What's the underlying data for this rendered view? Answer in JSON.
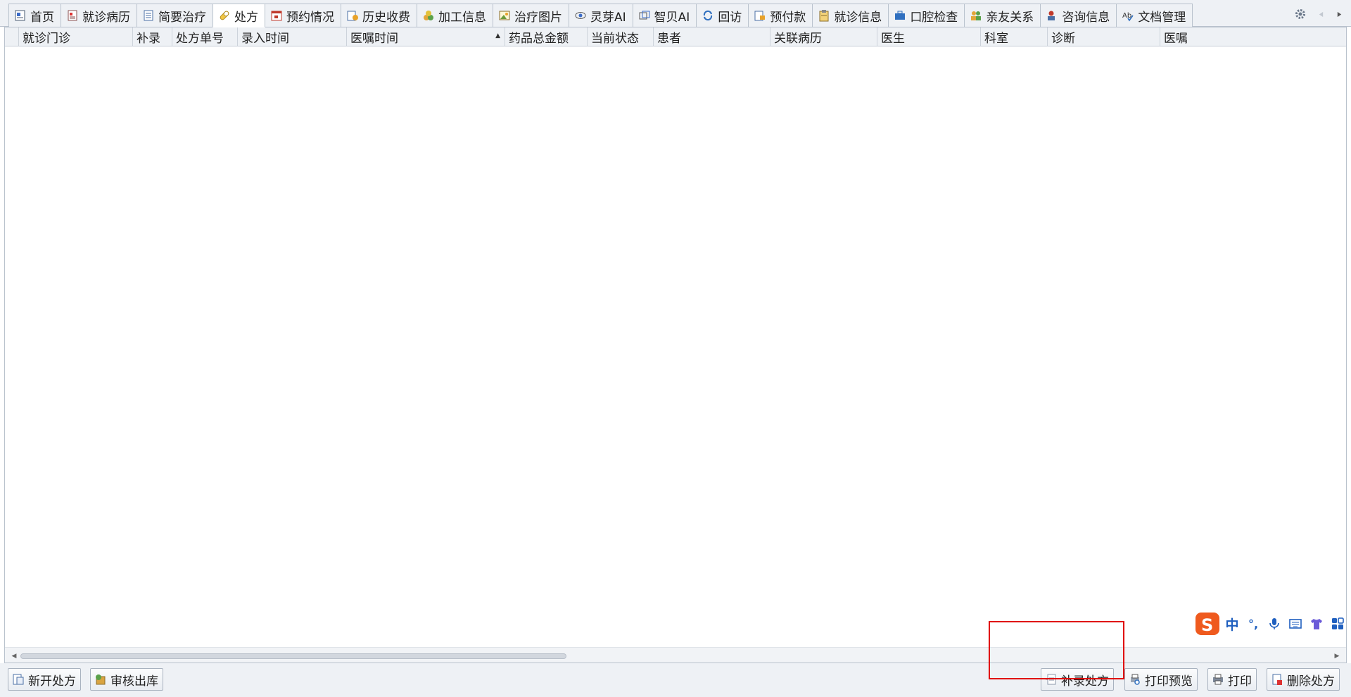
{
  "tabs": [
    {
      "label": "首页",
      "icon": "home-page-icon",
      "active": false
    },
    {
      "label": "就诊病历",
      "icon": "medical-record-icon",
      "active": false
    },
    {
      "label": "简要治疗",
      "icon": "document-icon",
      "active": false
    },
    {
      "label": "处方",
      "icon": "pill-icon",
      "active": true
    },
    {
      "label": "预约情况",
      "icon": "calendar-icon",
      "active": false
    },
    {
      "label": "历史收费",
      "icon": "billing-history-icon",
      "active": false
    },
    {
      "label": "加工信息",
      "icon": "processing-icon",
      "active": false
    },
    {
      "label": "治疗图片",
      "icon": "image-icon",
      "active": false
    },
    {
      "label": "灵芽AI",
      "icon": "eye-icon",
      "active": false
    },
    {
      "label": "智贝AI",
      "icon": "ai-window-icon",
      "active": false
    },
    {
      "label": "回访",
      "icon": "refresh-icon",
      "active": false
    },
    {
      "label": "预付款",
      "icon": "prepayment-icon",
      "active": false
    },
    {
      "label": "就诊信息",
      "icon": "clipboard-icon",
      "active": false
    },
    {
      "label": "口腔检查",
      "icon": "toolbox-icon",
      "active": false
    },
    {
      "label": "亲友关系",
      "icon": "people-icon",
      "active": false
    },
    {
      "label": "咨询信息",
      "icon": "consultant-icon",
      "active": false
    },
    {
      "label": "文档管理",
      "icon": "spellcheck-icon",
      "active": false
    }
  ],
  "tab_extras": {
    "settings_icon": "gear-icon",
    "prev_icon": "arrow-left-icon",
    "next_icon": "arrow-right-icon"
  },
  "grid": {
    "columns": [
      "就诊门诊",
      "补录",
      "处方单号",
      "录入时间",
      "医嘱时间",
      "药品总金额",
      "当前状态",
      "患者",
      "关联病历",
      "医生",
      "科室",
      "诊断",
      "医嘱"
    ],
    "sorted_column": "医嘱时间",
    "sort_direction": "ascending",
    "rows": []
  },
  "buttons": {
    "new_prescription": "新开处方",
    "review_dispatch": "审核出库",
    "supplement_prescription": "补录处方",
    "print_preview": "打印预览",
    "print": "打印",
    "delete_prescription": "删除处方"
  },
  "ime": {
    "mode_label": "中",
    "punct_label": "°,"
  },
  "colors": {
    "annotation_box": "#e00000",
    "tab_border": "#b9c2cd",
    "toolbar_bg": "#eef1f5"
  }
}
